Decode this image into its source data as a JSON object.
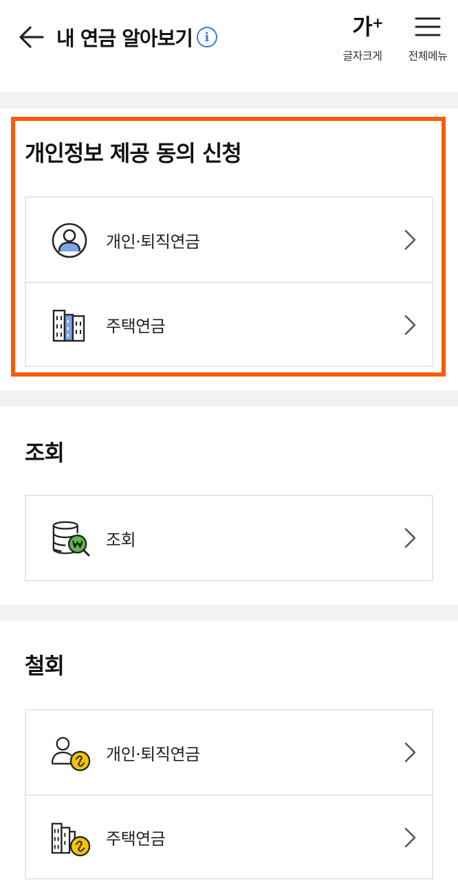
{
  "header": {
    "title": "내 연금 알아보기",
    "info_glyph": "i",
    "font_size_glyph": "가",
    "font_size_plus": "+",
    "font_size_label": "글자크게",
    "menu_label": "전체메뉴",
    "icons": [
      "arrow-left-icon",
      "info-icon",
      "hamburger-menu-icon"
    ]
  },
  "consent": {
    "title": "개인정보 제공 동의 신청",
    "items": [
      {
        "label": "개인·퇴직연금",
        "icon": "person-icon"
      },
      {
        "label": "주택연금",
        "icon": "building-icon"
      }
    ]
  },
  "inquiry": {
    "title": "조회",
    "items": [
      {
        "label": "조회",
        "icon": "database-search-icon"
      }
    ]
  },
  "withdraw": {
    "title": "철회",
    "items": [
      {
        "label": "개인·퇴직연금",
        "icon": "person-unlink-icon"
      },
      {
        "label": "주택연금",
        "icon": "building-unlink-icon"
      }
    ]
  },
  "colors": {
    "highlight": "#ff5a00",
    "accent_blue": "#3a78d6",
    "section_gap": "#f2f2f2",
    "badge_yellow": "#f5c400",
    "badge_green": "#5fb84a"
  }
}
